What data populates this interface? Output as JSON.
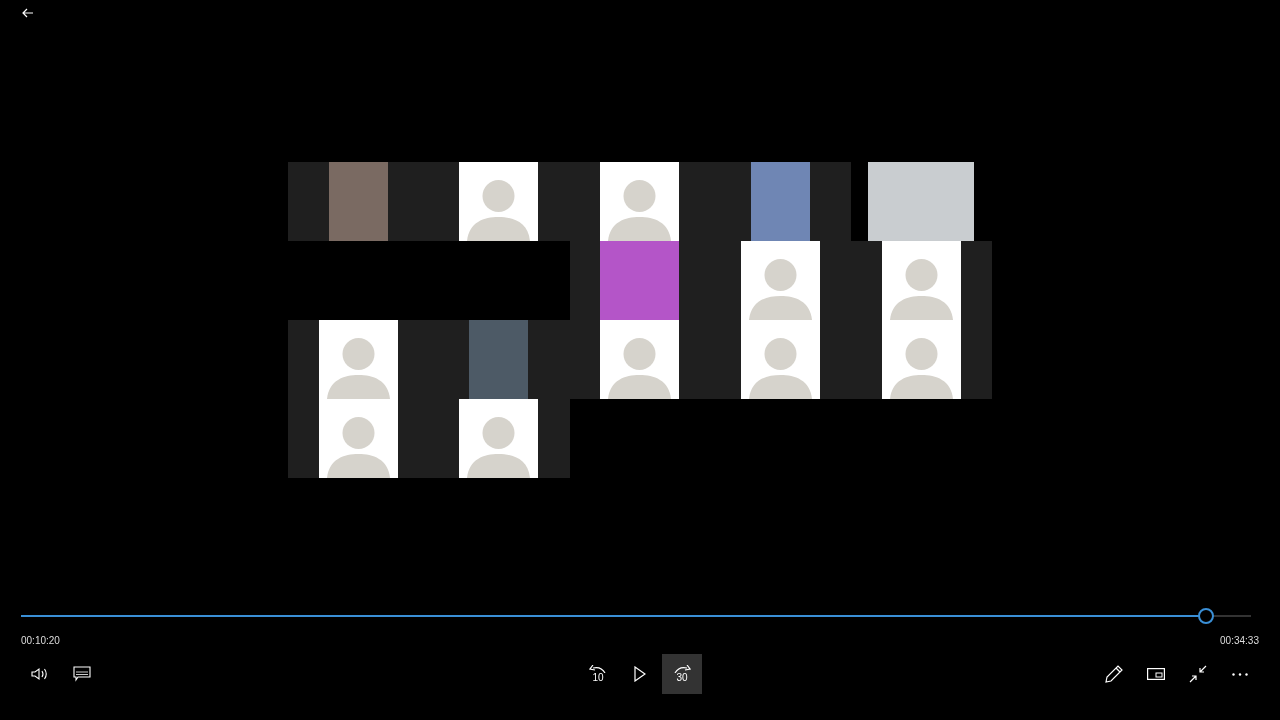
{
  "progress": {
    "level": 0.964,
    "elapsed": "00:10:20",
    "duration": "00:34:33"
  },
  "controls_left": [
    {
      "kind": "volume",
      "hovered": false
    },
    {
      "kind": "captions",
      "hovered": false
    }
  ],
  "controls_center": [
    {
      "kind": "skip-back",
      "label": "10",
      "hovered": false
    },
    {
      "kind": "play",
      "hovered": false
    },
    {
      "kind": "skip-forward",
      "label": "30",
      "hovered": true
    }
  ],
  "controls_right": [
    {
      "kind": "pen",
      "hovered": false
    },
    {
      "kind": "mini-view",
      "hovered": false
    },
    {
      "kind": "exit-fullscreen",
      "hovered": false
    },
    {
      "kind": "more",
      "hovered": false
    }
  ]
}
